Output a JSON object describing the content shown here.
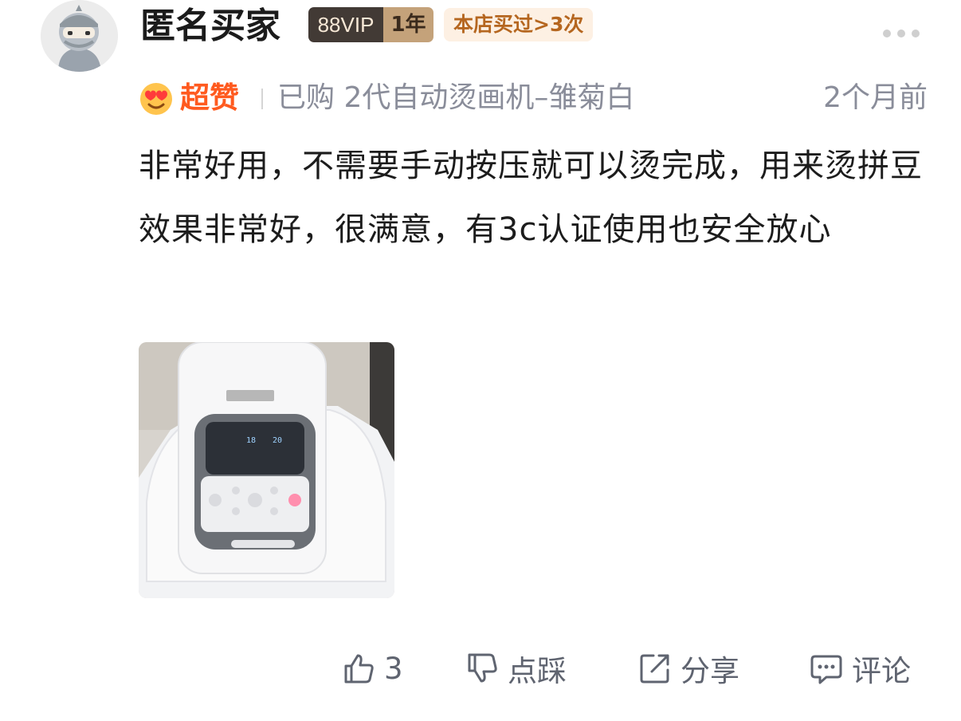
{
  "user": {
    "name": "匿名买家",
    "vip_label": "88VIP",
    "vip_years": "1年",
    "shop_badge": "本店买过>3次"
  },
  "review": {
    "rating_label": "超赞",
    "purchase_info": "已购 2代自动烫画机–雏菊白",
    "time": "2个月前",
    "text": "非常好用，不需要手动按压就可以烫完成，用来烫拼豆效果非常好，很满意，有3c认证使用也安全放心",
    "photo_icon": "heat-press-photo"
  },
  "actions": {
    "like_count": "3",
    "dislike_label": "点踩",
    "share_label": "分享",
    "comment_label": "评论"
  },
  "colors": {
    "accent_orange": "#ff5a1f",
    "meta_gray": "#8a8d9a",
    "action_gray": "#5f6470",
    "vip_dark": "#423a35",
    "vip_gold": "#c4a27a",
    "badge_bg": "#fdf0e3",
    "badge_text": "#b5661f"
  }
}
